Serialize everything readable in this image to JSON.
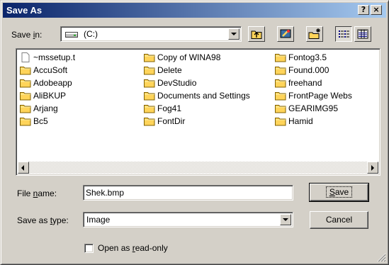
{
  "window": {
    "title": "Save As",
    "help_button": "?",
    "close_button": "×"
  },
  "save_in": {
    "label_pre": "Save ",
    "label_accel": "i",
    "label_post": "n:",
    "value": "(C:)",
    "icon": "drive-icon"
  },
  "toolbar": {
    "buttons": [
      {
        "name": "up-one-level-button",
        "icon": "up-folder-icon"
      },
      {
        "name": "desktop-button",
        "icon": "desktop-icon"
      },
      {
        "name": "create-new-folder-button",
        "icon": "new-folder-icon"
      },
      {
        "name": "list-view-button",
        "icon": "list-view-icon"
      },
      {
        "name": "details-view-button",
        "icon": "details-view-icon"
      }
    ]
  },
  "files": {
    "columns": [
      [
        "~mssetup.t",
        "AccuSoft",
        "Adobeapp",
        "AliBKUP",
        "Arjang",
        "Bc5"
      ],
      [
        "Copy of WINA98",
        "Delete",
        "DevStudio",
        "Documents and Settings",
        "Fog41",
        "FontDir"
      ],
      [
        "Fontog3.5",
        "Found.000",
        "freehand",
        "FrontPage Webs",
        "GEARIMG95",
        "Hamid"
      ]
    ]
  },
  "file_name": {
    "label_pre": "File ",
    "label_accel": "n",
    "label_post": "ame:",
    "value": "Shek.bmp"
  },
  "save_as_type": {
    "label_pre": "Save as ",
    "label_accel": "t",
    "label_post": "ype:",
    "value": "Image"
  },
  "buttons": {
    "save_accel": "S",
    "save_rest": "ave",
    "cancel": "Cancel"
  },
  "read_only": {
    "label_pre": "Open as ",
    "label_accel": "r",
    "label_post": "ead-only",
    "checked": false
  },
  "colors": {
    "title_start": "#0a246a",
    "title_end": "#a6caf0",
    "face": "#d4d0c8",
    "folder": "#ffd45a"
  }
}
